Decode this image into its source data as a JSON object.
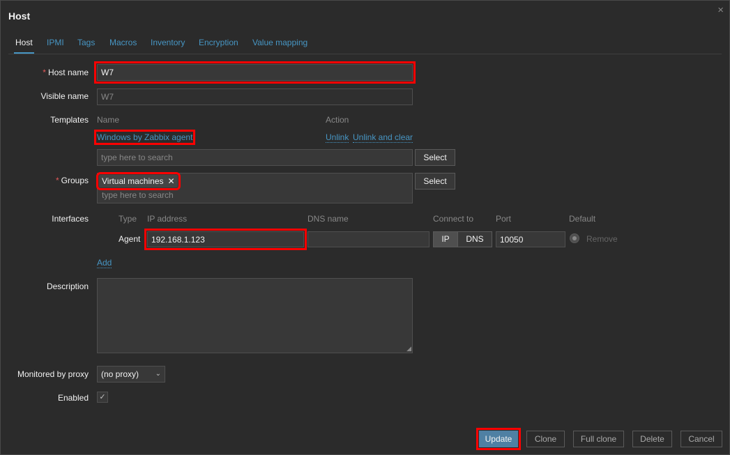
{
  "dialog": {
    "title": "Host",
    "close_icon": "×"
  },
  "tabs": [
    "Host",
    "IPMI",
    "Tags",
    "Macros",
    "Inventory",
    "Encryption",
    "Value mapping"
  ],
  "host_name": {
    "label": "Host name",
    "required_mark": "*",
    "value": "W7"
  },
  "visible_name": {
    "label": "Visible name",
    "placeholder": "W7"
  },
  "templates": {
    "label": "Templates",
    "col_name": "Name",
    "col_action": "Action",
    "linked": "Windows by Zabbix agent",
    "unlink": "Unlink",
    "unlink_clear": "Unlink and clear",
    "search_placeholder": "type here to search",
    "select_label": "Select"
  },
  "groups": {
    "label": "Groups",
    "required_mark": "*",
    "selected": "Virtual machines",
    "remove_icon": "✕",
    "search_placeholder": "type here to search",
    "select_label": "Select"
  },
  "interfaces": {
    "label": "Interfaces",
    "headers": {
      "type": "Type",
      "ip": "IP address",
      "dns": "DNS name",
      "connect": "Connect to",
      "port": "Port",
      "default": "Default"
    },
    "row": {
      "type": "Agent",
      "ip": "192.168.1.123",
      "dns": "",
      "connect_ip": "IP",
      "connect_dns": "DNS",
      "port": "10050",
      "remove": "Remove"
    },
    "add": "Add"
  },
  "description": {
    "label": "Description",
    "value": ""
  },
  "proxy": {
    "label": "Monitored by proxy",
    "value": "(no proxy)"
  },
  "enabled": {
    "label": "Enabled",
    "checked": true,
    "check_mark": "✓"
  },
  "footer": {
    "update": "Update",
    "clone": "Clone",
    "full_clone": "Full clone",
    "delete": "Delete",
    "cancel": "Cancel"
  },
  "colors": {
    "background": "#2b2b2b",
    "link": "#4796c4",
    "primary_button": "#4f80a3",
    "required": "#e45959",
    "highlight": "#ff0000"
  }
}
